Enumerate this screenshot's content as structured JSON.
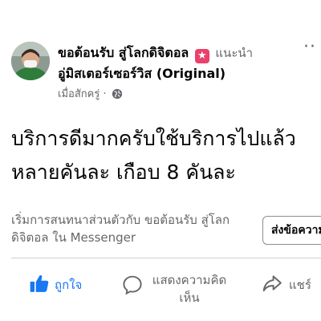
{
  "post": {
    "author_name": "ขอต้อนรับ สู่โลกดิจิตอล",
    "recommend_icon": "star-badge-icon",
    "recommend_label": "แนะนำ",
    "page_name": "อู่มิสเตอร์เซอร์วิส (Original)",
    "timestamp": "เมื่อสักครู่ ·",
    "privacy_icon": "globe-icon",
    "text_line1": "บริการดีมากครับใช้บริการไปแล้ว",
    "text_line2": "หลายคันละ เกือบ 8 คันละ"
  },
  "messenger": {
    "prompt_line1": "เริ่มการสนทนาส่วนตัวกับ ขอต้อนรับ สู่โลก",
    "prompt_line2": "ดิจิตอล ใน Messenger",
    "send_button_label": "ส่งข้อความ"
  },
  "actions": {
    "like_label": "ถูกใจ",
    "comment_label_line1": "แสดงความคิด",
    "comment_label_line2": "เห็น",
    "share_label": "แชร์"
  },
  "colors": {
    "accent": "#1877f2",
    "secondary_text": "#65676b",
    "recommend_badge": "#e9416b"
  }
}
